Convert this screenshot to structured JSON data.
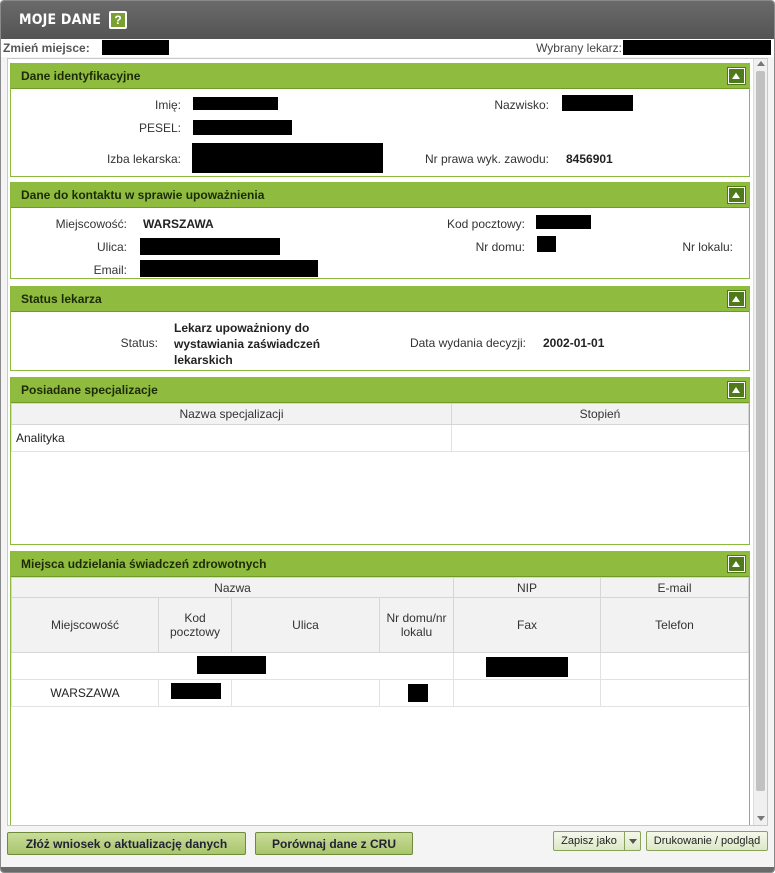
{
  "window": {
    "title": "MOJE DANE",
    "help_icon": "help-icon"
  },
  "location_bar": {
    "change_place_label": "Zmień miejsce:",
    "selected_doctor_label": "Wybrany lekarz:"
  },
  "sections": {
    "identification": {
      "title": "Dane identyfikacyjne",
      "first_name_label": "Imię:",
      "last_name_label": "Nazwisko:",
      "pesel_label": "PESEL:",
      "chamber_label": "Izba lekarska:",
      "license_label": "Nr prawa wyk. zawodu:",
      "license_value": "8456901"
    },
    "contact": {
      "title": "Dane do kontaktu w sprawie upoważnienia",
      "city_label": "Miejscowość:",
      "city_value": "WARSZAWA",
      "postal_label": "Kod pocztowy:",
      "street_label": "Ulica:",
      "house_label": "Nr domu:",
      "flat_label": "Nr lokalu:",
      "email_label": "Email:"
    },
    "status": {
      "title": "Status lekarza",
      "status_label": "Status:",
      "status_value": "Lekarz upoważniony do wystawiania zaświadczeń lekarskich",
      "decision_label": "Data wydania decyzji:",
      "decision_value": "2002-01-01"
    },
    "specializations": {
      "title": "Posiadane specjalizacje",
      "columns": [
        "Nazwa specjalizacji",
        "Stopień"
      ],
      "rows": [
        {
          "name": "Analityka",
          "degree": ""
        }
      ]
    },
    "places": {
      "title": "Miejsca udzielania świadczeń zdrowotnych",
      "header_top": {
        "name": "Nazwa",
        "nip": "NIP",
        "email": "E-mail"
      },
      "header_bottom": {
        "city": "Miejscowość",
        "postal": "Kod pocztowy",
        "street": "Ulica",
        "house": "Nr domu/nr lokalu",
        "fax": "Fax",
        "phone": "Telefon"
      },
      "rows": [
        {
          "city": "WARSZAWA"
        }
      ]
    }
  },
  "footer": {
    "request_update_label": "Złóż wniosek o aktualizację danych",
    "compare_cru_label": "Porównaj dane z CRU",
    "save_as_label": "Zapisz jako",
    "print_label": "Drukowanie / podgląd"
  },
  "colors": {
    "accent": "#8fbc3f",
    "titlebar": "#5f5f5f",
    "redaction": "#000000"
  }
}
